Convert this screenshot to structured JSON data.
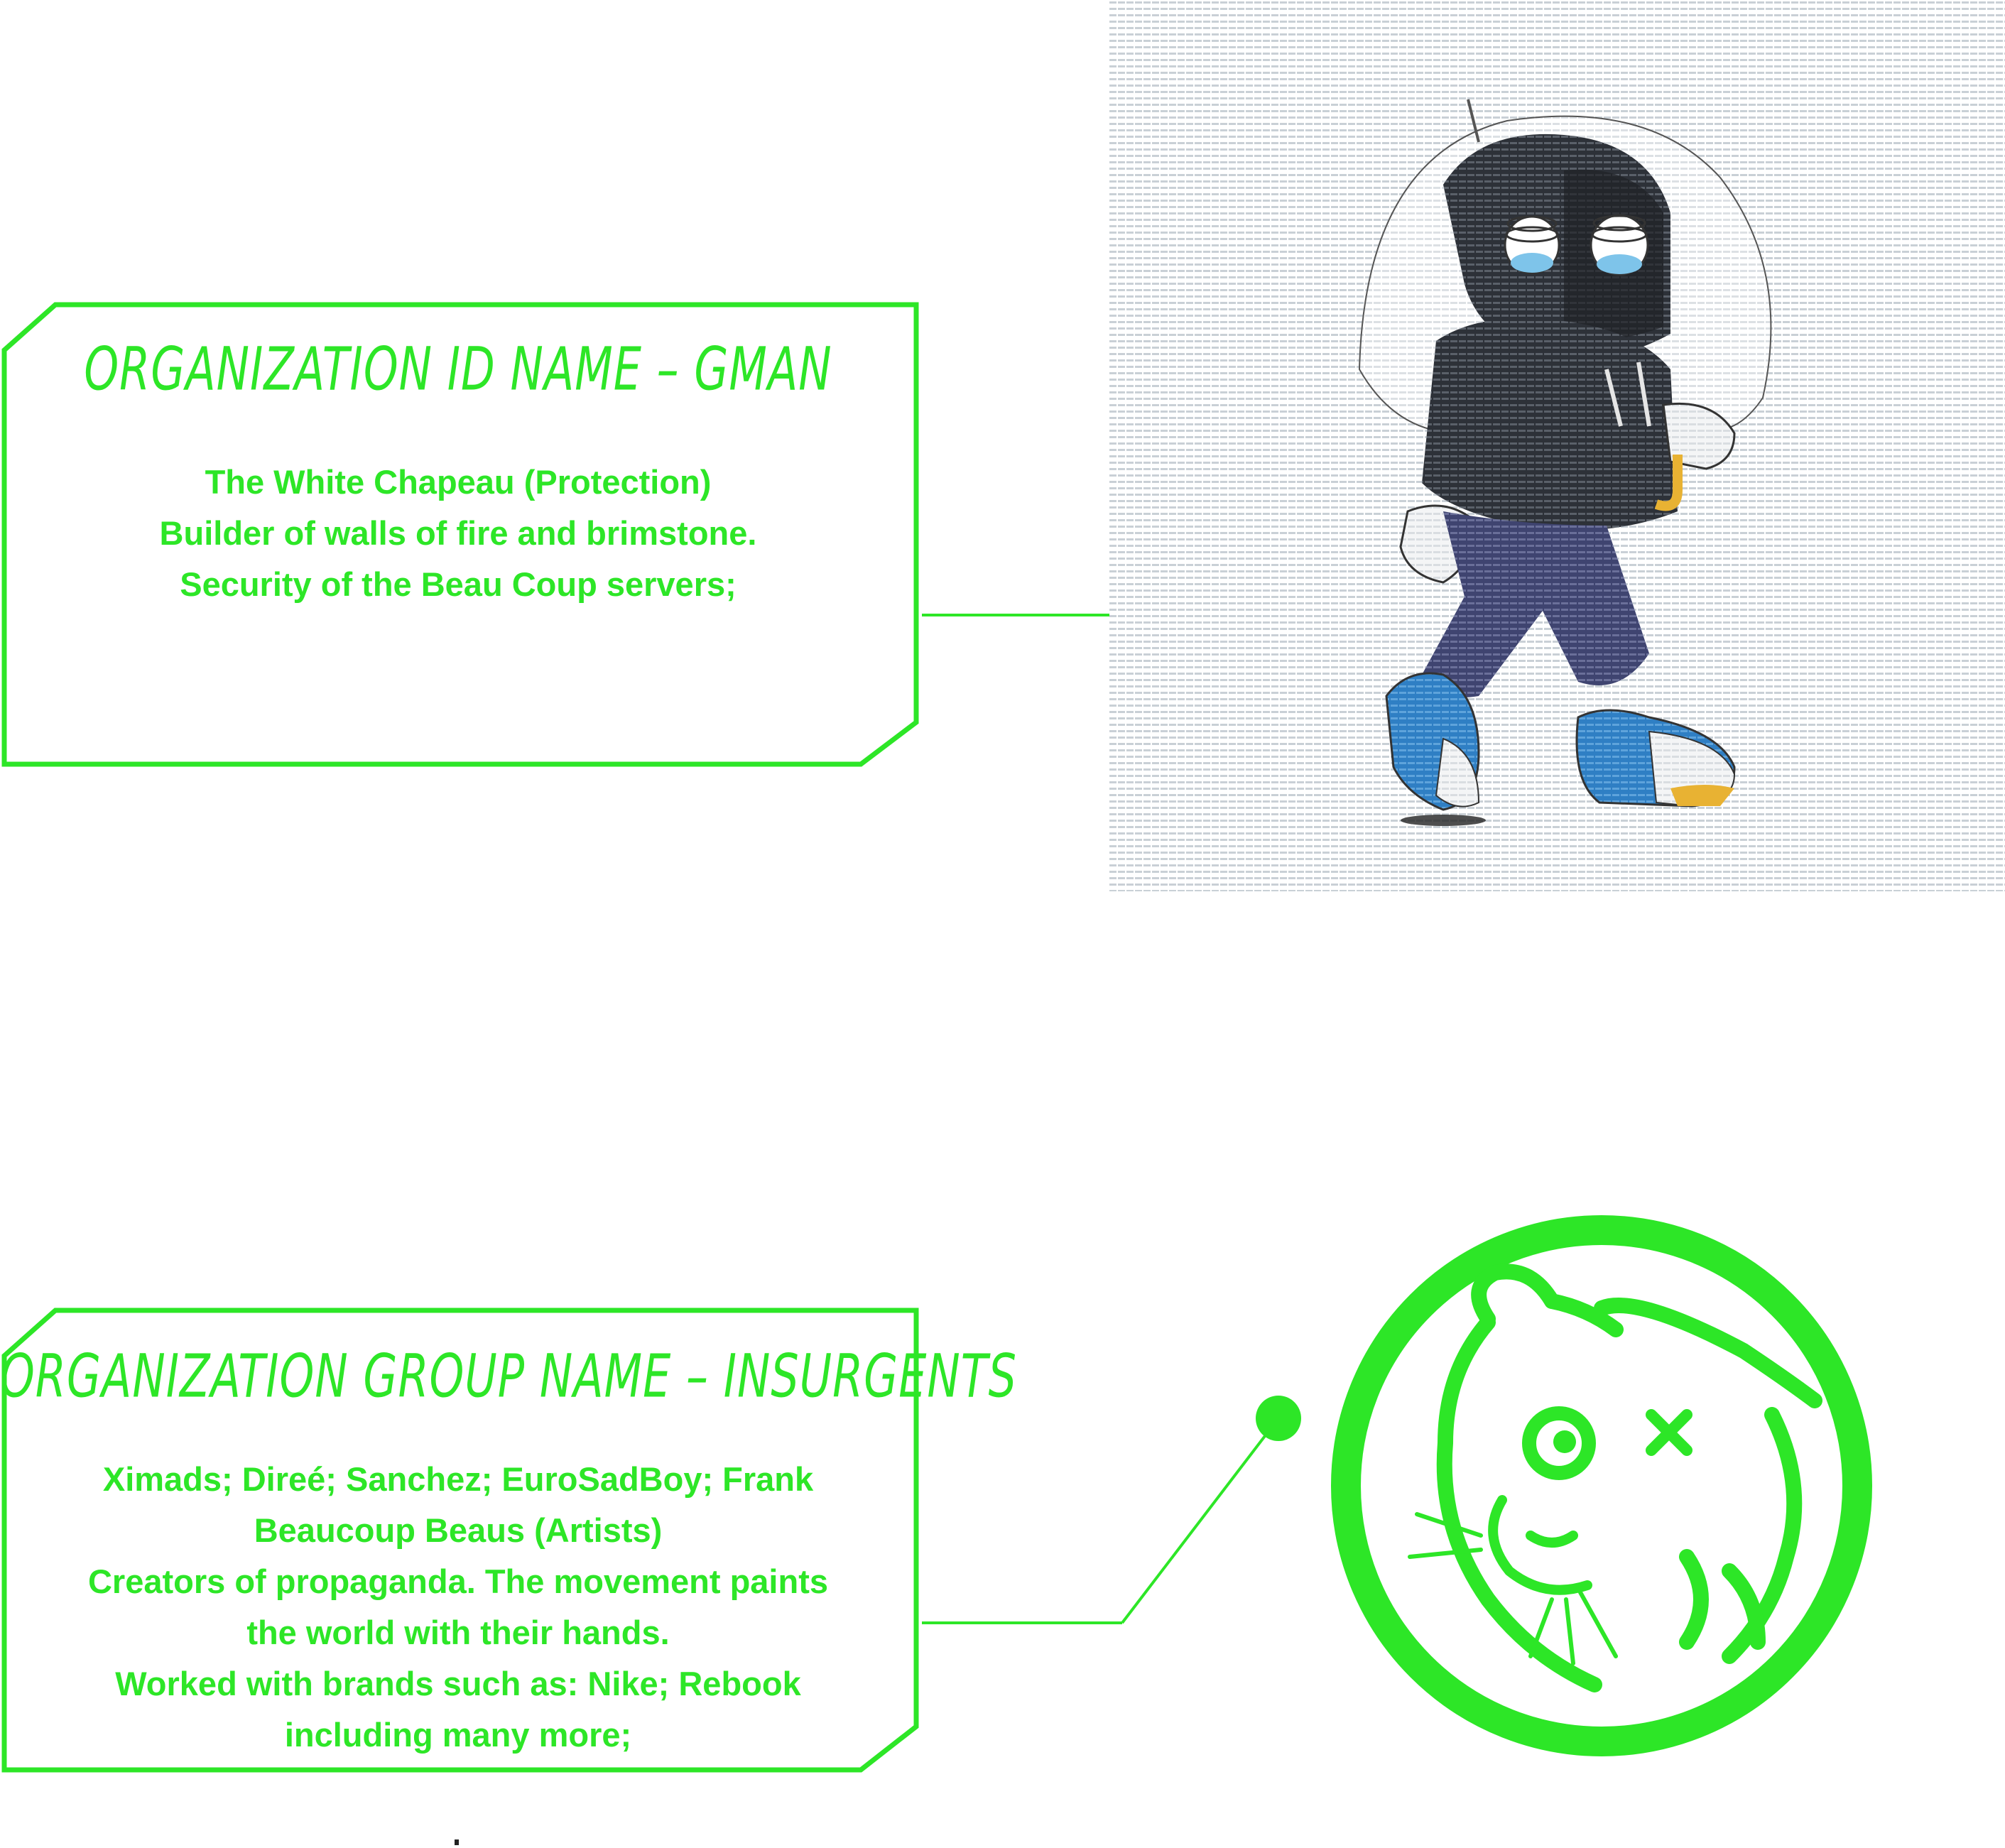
{
  "colors": {
    "accent": "#2de627",
    "background": "#ffffff"
  },
  "cards": {
    "gman": {
      "title": "ORGANIZATION ID NAME – GMAN",
      "lines": [
        "The White Chapeau (Protection)",
        "Builder of walls of fire and brimstone.",
        "Security of the Beau Coup servers;"
      ]
    },
    "insurgents": {
      "title": "ORGANIZATION GROUP NAME – INSURGENTS",
      "lines": [
        "Ximads; Direé; Sanchez; EuroSadBoy; Frank",
        "Beaucoup Beaus (Artists)",
        "Creators of propaganda. The movement paints",
        "the world with their hands.",
        "Worked with brands such as: Nike; Rebook",
        "including many more;"
      ]
    }
  },
  "images": {
    "character": "hooded-character-with-umbrella-illustration",
    "logo": "circle-hamster-stamp-logo"
  }
}
